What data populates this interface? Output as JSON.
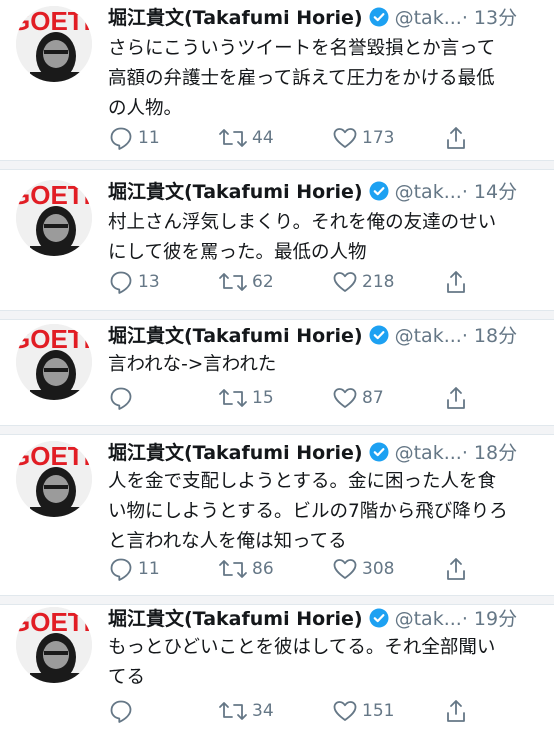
{
  "tweets": [
    {
      "name": "堀江貴文(Takafumi Horie)",
      "handle": "@tak...",
      "time": "· 13分",
      "lines": [
        "さらにこういうツイートを名誉毀損とか言って",
        "高額の弁護士を雇って訴えて圧力をかける最低",
        "の人物。"
      ],
      "replies": "11",
      "retweets": "44",
      "likes": "173"
    },
    {
      "name": "堀江貴文(Takafumi Horie)",
      "handle": "@tak...",
      "time": "· 14分",
      "lines": [
        "村上さん浮気しまくり。それを俺の友達のせい",
        "にして彼を罵った。最低の人物"
      ],
      "replies": "13",
      "retweets": "62",
      "likes": "218"
    },
    {
      "name": "堀江貴文(Takafumi Horie)",
      "handle": "@tak...",
      "time": "· 18分",
      "lines": [
        "言われな->言われた"
      ],
      "replies": "",
      "retweets": "15",
      "likes": "87"
    },
    {
      "name": "堀江貴文(Takafumi Horie)",
      "handle": "@tak...",
      "time": "· 18分",
      "lines": [
        "人を金で支配しようとする。金に困った人を食",
        "い物にしようとする。ビルの7階から飛び降りろ",
        "と言われな人を俺は知ってる"
      ],
      "replies": "11",
      "retweets": "86",
      "likes": "308"
    },
    {
      "name": "堀江貴文(Takafumi Horie)",
      "handle": "@tak...",
      "time": "· 19分",
      "lines": [
        "もっとひどいことを彼はしてる。それ全部聞い",
        "てる"
      ],
      "replies": "",
      "retweets": "34",
      "likes": "151"
    }
  ],
  "icons": {
    "reply": "reply-icon",
    "retweet": "retweet-icon",
    "like": "heart-icon",
    "share": "share-icon",
    "verified": "verified-badge-icon"
  },
  "colors": {
    "verified": "#1da1f2",
    "meta": "#657786",
    "text": "#14171a",
    "divider": "#f3f4f6"
  }
}
